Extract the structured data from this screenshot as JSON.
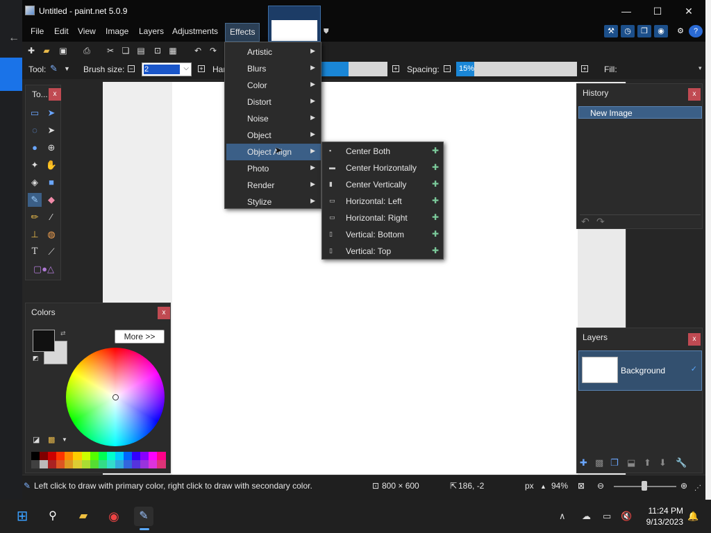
{
  "window": {
    "title": "Untitled - paint.net 5.0.9",
    "minimize": "—",
    "maximize": "☐",
    "close": "✕"
  },
  "menu": [
    "File",
    "Edit",
    "View",
    "Image",
    "Layers",
    "Adjustments",
    "Effects"
  ],
  "toolbar": {
    "tool_label": "Tool:",
    "brush_size_label": "Brush size:",
    "brush_size_value": "2",
    "hardness_label": "Har",
    "spacing_label": "Spacing:",
    "spacing_value": "15%",
    "fill_label": "Fill:",
    "hardness_fraction": 0.52,
    "spacing_fraction": 0.15
  },
  "tools_panel": {
    "title": "To..."
  },
  "colors_panel": {
    "title": "Colors",
    "more_button": "More >>"
  },
  "history_panel": {
    "title": "History",
    "items": [
      "New Image"
    ]
  },
  "layers_panel": {
    "title": "Layers",
    "layers": [
      "Background"
    ],
    "check": "✓"
  },
  "effects_menu": {
    "items": [
      "Artistic",
      "Blurs",
      "Color",
      "Distort",
      "Noise",
      "Object",
      "Object Align",
      "Photo",
      "Render",
      "Stylize"
    ],
    "highlighted": "Object Align"
  },
  "object_align_menu": {
    "items": [
      "Center Both",
      "Center Horizontally",
      "Center Vertically",
      "Horizontal: Left",
      "Horizontal: Right",
      "Vertical: Bottom",
      "Vertical: Top"
    ]
  },
  "status": {
    "hint": "Left click to draw with primary color, right click to draw with secondary color.",
    "image_size": "800 × 600",
    "cursor_pos": "186, -2",
    "unit": "px",
    "zoom": "94%"
  },
  "taskbar": {
    "time": "11:24 PM",
    "date": "9/13/2023"
  },
  "colors": {
    "accent": "#3b5f87",
    "close": "#c04a52",
    "palette": [
      "#000000",
      "#7f0000",
      "#cc0000",
      "#ff3300",
      "#ff8800",
      "#ffcc00",
      "#ccff00",
      "#55ff00",
      "#00ff55",
      "#00ffcc",
      "#00ccff",
      "#0066ff",
      "#3300ff",
      "#8800ff",
      "#ff00ff",
      "#ff0088",
      "#404040",
      "#bbbbbb",
      "#aa2222",
      "#dd5522",
      "#dd9922",
      "#ddcc33",
      "#aadd33",
      "#55dd33",
      "#33dd88",
      "#33ddcc",
      "#33aadd",
      "#3366dd",
      "#5533dd",
      "#9933dd",
      "#dd33dd",
      "#dd3377"
    ]
  }
}
